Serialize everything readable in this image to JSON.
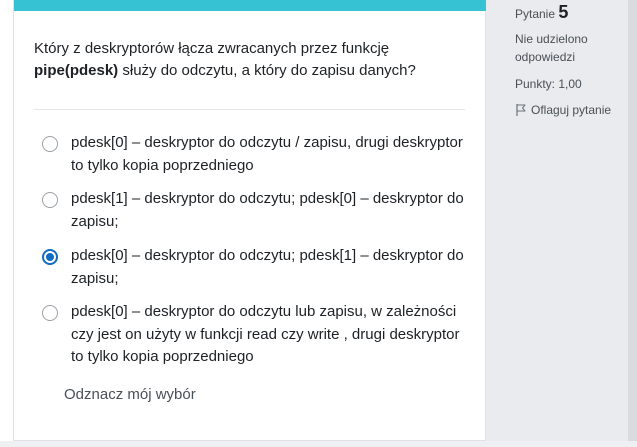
{
  "question": {
    "text_part1": "Który z deskryptorów łącza zwracanych przez funkcję",
    "text_bold": "pipe(pdesk)",
    "text_part2": " służy do odczytu, a który do zapisu danych?"
  },
  "answers": [
    {
      "label": "pdesk[0] – deskryptor do odczytu / zapisu, drugi deskryptor to tylko kopia poprzedniego",
      "selected": false
    },
    {
      "label": "pdesk[1] – deskryptor do odczytu;  pdesk[0] – deskryptor do zapisu;",
      "selected": false
    },
    {
      "label": "pdesk[0] – deskryptor do odczytu;  pdesk[1] – deskryptor do zapisu;",
      "selected": true
    },
    {
      "label": "pdesk[0] – deskryptor do odczytu lub zapisu, w zależności czy jest on użyty w funkcji read czy write , drugi deskryptor to tylko kopia poprzedniego",
      "selected": false
    }
  ],
  "clear_choice_label": "Odznacz mój wybór",
  "info": {
    "question_label": "Pytanie",
    "question_number": "5",
    "status": "Nie udzielono odpowiedzi",
    "points": "Punkty: 1,00",
    "flag_label": "Oflaguj pytanie",
    "flag_icon": "flag-icon"
  },
  "colors": {
    "accent_bar": "#37c2d4",
    "radio_selected": "#0f6cbf",
    "info_panel_bg": "#e9ebee"
  }
}
